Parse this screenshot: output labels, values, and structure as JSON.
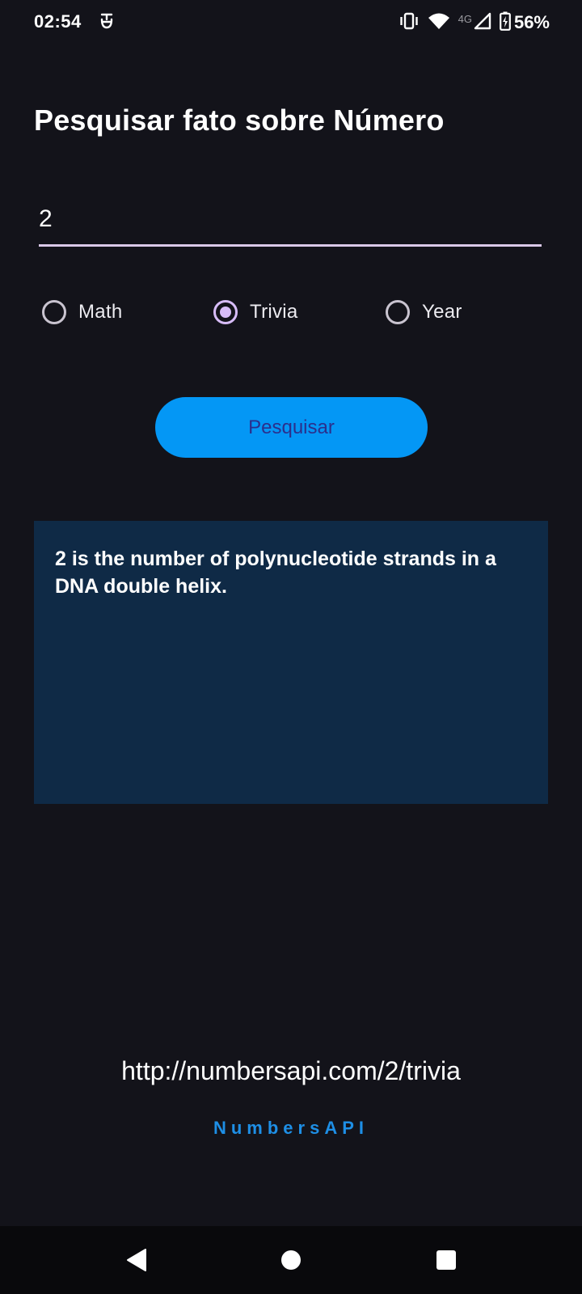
{
  "status_bar": {
    "time": "02:54",
    "network_label": "4G",
    "battery_percent": "56%",
    "icons": [
      "vibrate-icon",
      "wifi-icon",
      "cell-signal-icon",
      "battery-charging-icon"
    ]
  },
  "page": {
    "title": "Pesquisar fato sobre Número"
  },
  "input": {
    "value": "2"
  },
  "radio_options": [
    {
      "label": "Math",
      "checked": false
    },
    {
      "label": "Trivia",
      "checked": true
    },
    {
      "label": "Year",
      "checked": false
    }
  ],
  "search_button": {
    "label": "Pesquisar"
  },
  "result": {
    "text": "2 is the number of polynucleotide strands in a DNA double helix."
  },
  "footer": {
    "url": "http://numbersapi.com/2/trivia",
    "api_name": "NumbersAPI"
  },
  "colors": {
    "background": "#13131a",
    "accent_button": "#0497f5",
    "result_box": "#0f2a46",
    "radio_checked": "#d7bcf7",
    "api_name": "#1e8fe6"
  }
}
